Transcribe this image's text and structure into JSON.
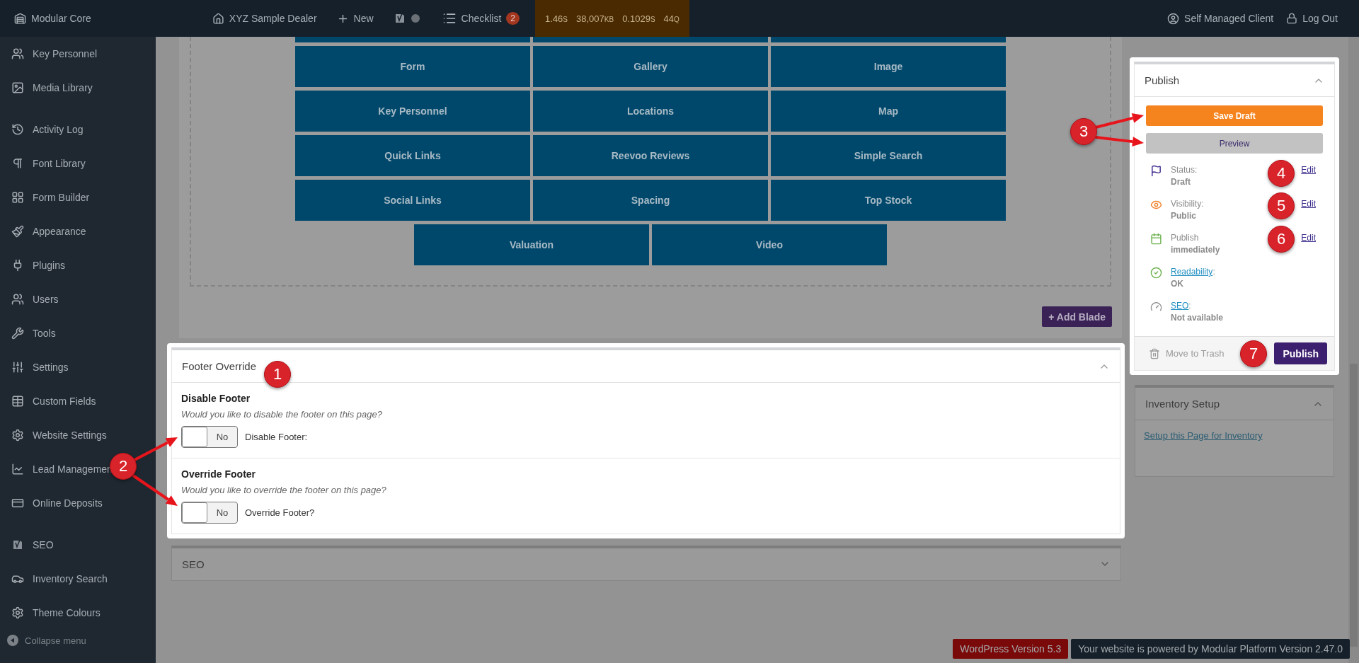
{
  "top_bar": {
    "site": "Modular Core",
    "dealer": "XYZ Sample Dealer",
    "new": "New",
    "checklist": "Checklist",
    "checklist_count": "2",
    "stats": [
      {
        "value": "1.46",
        "unit": "S"
      },
      {
        "value": "38,007",
        "unit": "KB"
      },
      {
        "value": "0.1029",
        "unit": "S"
      },
      {
        "value": "44",
        "unit": "Q"
      }
    ],
    "user": "Self Managed Client",
    "logout": "Log Out"
  },
  "sidebar": {
    "groups": [
      [
        "Key Personnel",
        "Media Library"
      ],
      [
        "Activity Log",
        "Font Library",
        "Form Builder",
        "Appearance",
        "Plugins",
        "Users",
        "Tools",
        "Settings",
        "Custom Fields",
        "Website Settings",
        "Lead Managemen",
        "Online Deposits"
      ],
      [
        "SEO",
        "Inventory Search",
        "Theme Colours"
      ]
    ],
    "collapse": "Collapse menu"
  },
  "blades": {
    "rows": [
      [
        "Form",
        "Gallery",
        "Image"
      ],
      [
        "Key Personnel",
        "Locations",
        "Map"
      ],
      [
        "Quick Links",
        "Reevoo Reviews",
        "Simple Search"
      ],
      [
        "Social Links",
        "Spacing",
        "Top Stock"
      ],
      [
        "Valuation",
        "Video"
      ]
    ],
    "add_button": "+ Add Blade"
  },
  "footer_override": {
    "title": "Footer Override",
    "expanded": true,
    "fields": [
      {
        "title": "Disable Footer",
        "hint": "Would you like to disable the footer on this page?",
        "toggle": "No",
        "on": false,
        "caption": "Disable Footer:"
      },
      {
        "title": "Override Footer",
        "hint": "Would you like to override the footer on this page?",
        "toggle": "No",
        "on": false,
        "caption": "Override Footer?"
      }
    ]
  },
  "seo_panel": {
    "title": "SEO",
    "expanded": false
  },
  "publish": {
    "title": "Publish",
    "save_draft": "Save Draft",
    "preview": "Preview",
    "rows": [
      {
        "label": "Status:",
        "value": "Draft",
        "edit": "Edit"
      },
      {
        "label": "Visibility:",
        "value": "Public",
        "edit": "Edit"
      },
      {
        "label": "Publish",
        "value": "immediately",
        "edit": "Edit"
      },
      {
        "label": "Readability",
        "label_link": true,
        "suffix": ":",
        "value": "OK"
      },
      {
        "label": "SEO",
        "label_link": true,
        "suffix": ":",
        "value": "Not available"
      }
    ],
    "trash": "Move to Trash",
    "publish_button": "Publish"
  },
  "inventory_setup": {
    "title": "Inventory Setup",
    "link": "Setup this Page for Inventory"
  },
  "footer": {
    "wordpress": "WordPress Version 5.3",
    "powered": "Your website is powered by Modular Platform Version 2.47.0"
  },
  "annotations": [
    "1",
    "2",
    "3",
    "4",
    "5",
    "6",
    "7"
  ]
}
